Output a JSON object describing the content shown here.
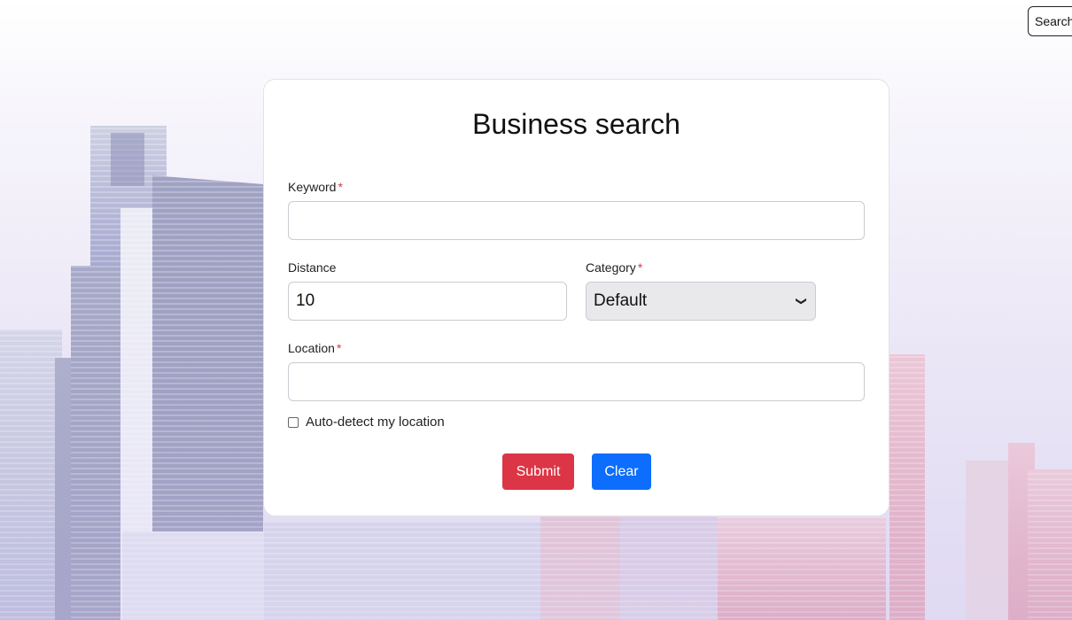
{
  "nav": {
    "search_label": "Search"
  },
  "form": {
    "title": "Business search",
    "keyword": {
      "label": "Keyword",
      "required_mark": "*",
      "value": ""
    },
    "distance": {
      "label": "Distance",
      "value": "10"
    },
    "category": {
      "label": "Category",
      "required_mark": "*",
      "selected": "Default"
    },
    "location": {
      "label": "Location",
      "required_mark": "*",
      "value": ""
    },
    "auto_detect": {
      "label": "Auto-detect my location",
      "checked": false
    },
    "submit_label": "Submit",
    "clear_label": "Clear"
  },
  "colors": {
    "submit": "#dc3545",
    "clear": "#0d6efd",
    "required": "#dc3545"
  },
  "icons": {
    "category_dropdown": "chevron-down-icon"
  }
}
